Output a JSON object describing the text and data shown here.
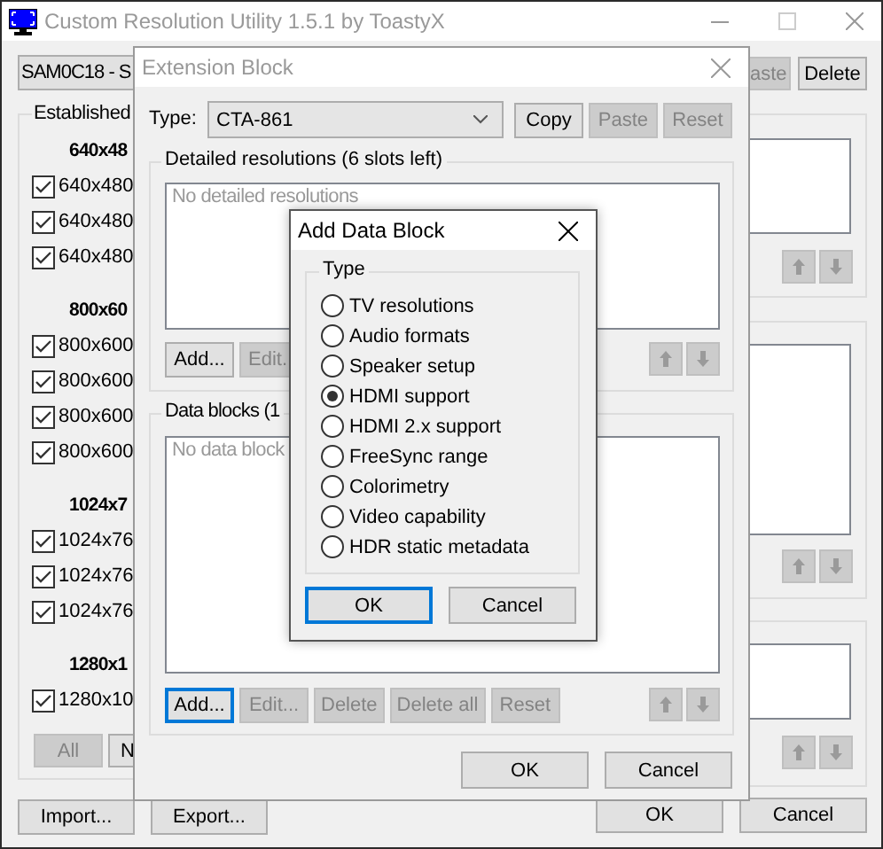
{
  "main_window": {
    "title": "Custom Resolution Utility 1.5.1 by ToastyX",
    "device_select": "SAM0C18 - S",
    "top_buttons": [
      {
        "label": "aste",
        "disabled": true
      },
      {
        "label": "Delete",
        "disabled": false
      }
    ],
    "established": {
      "label": "Established",
      "groups": [
        {
          "heading": "640x48",
          "items": [
            {
              "label": "640x480",
              "checked": true
            },
            {
              "label": "640x480",
              "checked": true
            },
            {
              "label": "640x480",
              "checked": true
            }
          ]
        },
        {
          "heading": "800x60",
          "items": [
            {
              "label": "800x600",
              "checked": true
            },
            {
              "label": "800x600",
              "checked": true
            },
            {
              "label": "800x600",
              "checked": true
            },
            {
              "label": "800x600",
              "checked": true
            }
          ]
        },
        {
          "heading": "1024x7",
          "items": [
            {
              "label": "1024x76",
              "checked": true
            },
            {
              "label": "1024x76",
              "checked": true
            },
            {
              "label": "1024x76",
              "checked": true
            }
          ]
        },
        {
          "heading": "1280x1",
          "items": [
            {
              "label": "1280x10",
              "checked": true
            }
          ]
        }
      ],
      "buttons": [
        {
          "label": "All",
          "disabled": true
        },
        {
          "label": "N",
          "disabled": false
        }
      ]
    },
    "footer_left": [
      {
        "label": "Import...",
        "disabled": false
      },
      {
        "label": "Export...",
        "disabled": false
      }
    ],
    "footer_right": [
      {
        "label": "OK",
        "disabled": false
      },
      {
        "label": "Cancel",
        "disabled": false
      }
    ]
  },
  "extension_block": {
    "title": "Extension Block",
    "type_label": "Type:",
    "type_value": "CTA-861",
    "type_buttons": [
      {
        "label": "Copy",
        "disabled": false
      },
      {
        "label": "Paste",
        "disabled": true
      },
      {
        "label": "Reset",
        "disabled": true
      }
    ],
    "detailed": {
      "label": "Detailed resolutions (6 slots left)",
      "placeholder": "No detailed resolutions",
      "buttons": [
        {
          "label": "Add...",
          "disabled": false,
          "focused": false
        },
        {
          "label": "Edit.",
          "disabled": true,
          "focused": false
        }
      ]
    },
    "data_blocks": {
      "label": "Data blocks (1",
      "placeholder": "No data block",
      "buttons": [
        {
          "label": "Add...",
          "disabled": false,
          "focused": true
        },
        {
          "label": "Edit...",
          "disabled": true,
          "focused": false
        },
        {
          "label": "Delete",
          "disabled": true,
          "focused": false
        },
        {
          "label": "Delete all",
          "disabled": true,
          "focused": false
        },
        {
          "label": "Reset",
          "disabled": true,
          "focused": false
        }
      ]
    },
    "footer": [
      {
        "label": "OK",
        "focused": false
      },
      {
        "label": "Cancel",
        "focused": false
      }
    ]
  },
  "add_data_block": {
    "title": "Add Data Block",
    "group_label": "Type",
    "options": [
      {
        "label": "TV resolutions",
        "selected": false
      },
      {
        "label": "Audio formats",
        "selected": false
      },
      {
        "label": "Speaker setup",
        "selected": false
      },
      {
        "label": "HDMI support",
        "selected": true
      },
      {
        "label": "HDMI 2.x support",
        "selected": false
      },
      {
        "label": "FreeSync range",
        "selected": false
      },
      {
        "label": "Colorimetry",
        "selected": false
      },
      {
        "label": "Video capability",
        "selected": false
      },
      {
        "label": "HDR static metadata",
        "selected": false
      }
    ],
    "footer": [
      {
        "label": "OK",
        "focused": true
      },
      {
        "label": "Cancel",
        "focused": false
      }
    ]
  }
}
